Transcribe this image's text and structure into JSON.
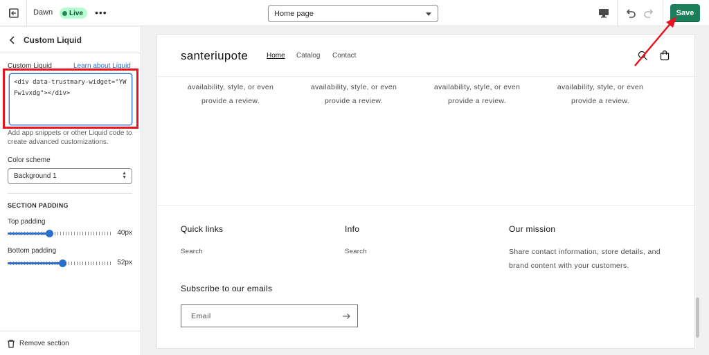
{
  "topbar": {
    "theme_name": "Dawn",
    "live_badge": "Live",
    "page_select_value": "Home page",
    "save_label": "Save"
  },
  "sidebar": {
    "title": "Custom Liquid",
    "custom_liquid_label": "Custom Liquid",
    "learn_link": "Learn about Liquid",
    "code_value": "<div data-trustmary-widget=\"YWFw1vxdg\"></div>",
    "help_text": "Add app snippets or other Liquid code to create advanced customizations.",
    "color_scheme_label": "Color scheme",
    "color_scheme_value": "Background 1",
    "section_padding_heading": "SECTION PADDING",
    "top_padding": {
      "label": "Top padding",
      "value_text": "40px",
      "fraction": 0.4
    },
    "bottom_padding": {
      "label": "Bottom padding",
      "value_text": "52px",
      "fraction": 0.52
    },
    "remove_section": "Remove section"
  },
  "preview": {
    "store_name": "santeriupote",
    "nav": [
      "Home",
      "Catalog",
      "Contact"
    ],
    "review_text": [
      "availability, style, or even",
      "provide a review."
    ],
    "footer": {
      "quick_links": {
        "heading": "Quick links",
        "link": "Search"
      },
      "info": {
        "heading": "Info",
        "link": "Search"
      },
      "mission": {
        "heading": "Our mission",
        "text": "Share contact information, store details, and brand content with your customers."
      },
      "subscribe_heading": "Subscribe to our emails",
      "email_placeholder": "Email"
    }
  },
  "colors": {
    "save_button": "#1a7f5a",
    "link": "#2c6ecb",
    "highlight_box": "#e8131c",
    "annotation_arrow": "#e8131c"
  }
}
